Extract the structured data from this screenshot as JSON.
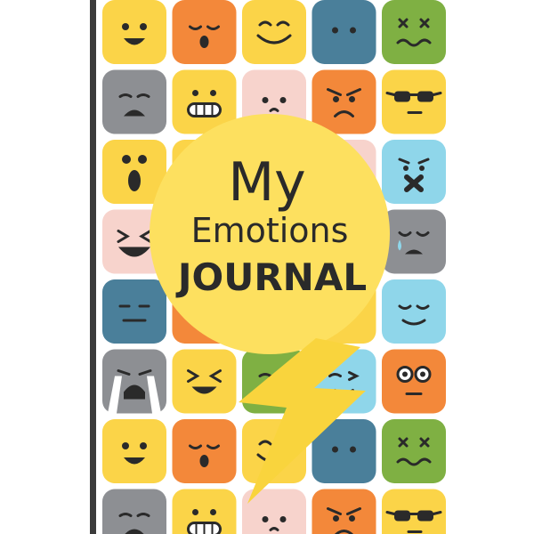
{
  "cover": {
    "title_line1": "My",
    "title_line2": "Emotions",
    "title_line3": "JOURNAL"
  },
  "colors": {
    "yellow": "#fbd448",
    "orange": "#f3883a",
    "blue": "#4a7f9a",
    "green": "#7fb043",
    "gray": "#8d8f93",
    "pink": "#f7d3cc",
    "light_blue": "#8fd6ea",
    "circle": "#fde05f",
    "bolt": "#f9d43d",
    "ink": "#2a2a2a",
    "spine": "#3b3b3b"
  },
  "emoji_rows": [
    [
      "yellow-smile",
      "orange-sleepy",
      "yellow-happy",
      "blue-neutral-dots",
      "green-dizzy"
    ],
    [
      "gray-sad",
      "yellow-grimace",
      "pink-nervous",
      "orange-angry",
      "yellow-sunglasses"
    ],
    [
      "yellow-surprised",
      "yellow-hidden",
      "pink-hidden",
      "pink-hidden",
      "light-blue-silenced"
    ],
    [
      "pink-laughing",
      "yellow-hidden",
      "yellow-hidden",
      "yellow-hidden",
      "gray-crying"
    ],
    [
      "blue-flat",
      "orange-hidden",
      "yellow-hidden",
      "yellow-hidden",
      "light-blue-content"
    ],
    [
      "gray-sobbing",
      "yellow-grin",
      "green-wink",
      "light-blue-wink",
      "orange-shocked"
    ],
    [
      "yellow-smile",
      "orange-sleepy",
      "yellow-happy",
      "blue-neutral-dots",
      "green-dizzy"
    ],
    [
      "gray-sad",
      "yellow-grimace",
      "pink-nervous",
      "orange-angry",
      "yellow-sunglasses"
    ]
  ]
}
